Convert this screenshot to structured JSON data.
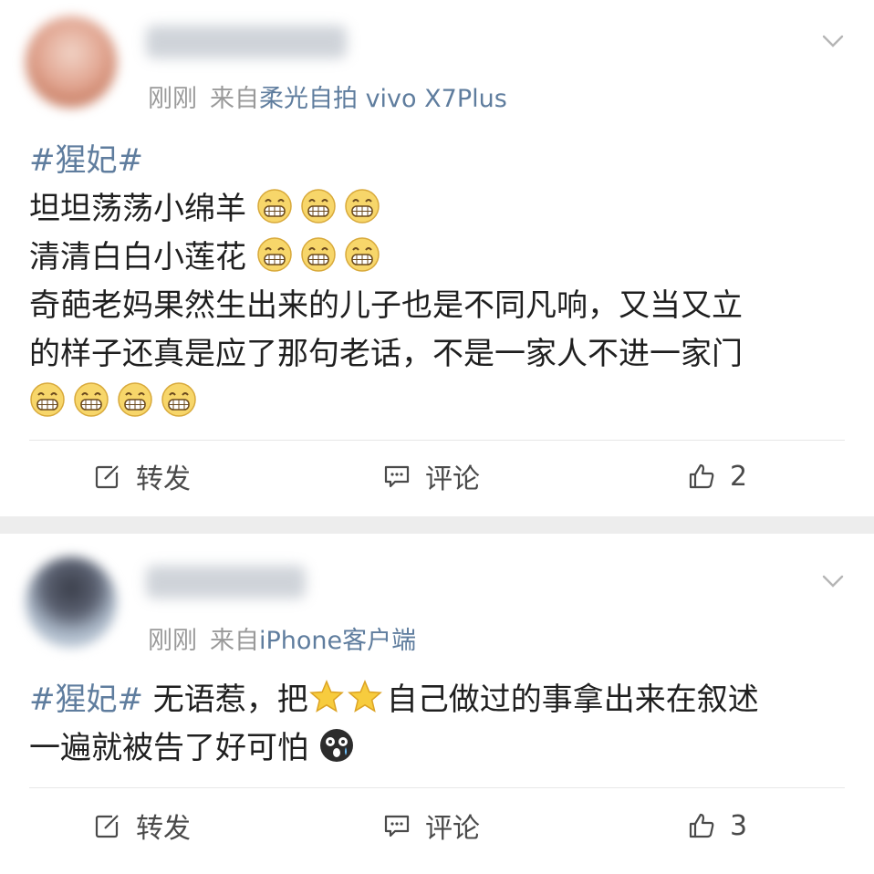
{
  "posts": [
    {
      "time": "刚刚",
      "source_prefix": "来自",
      "source": "柔光自拍 vivo X7Plus",
      "lines": [
        {
          "tag": "#猩妃#",
          "text": "",
          "emojis_after": []
        },
        {
          "tag": "",
          "text": "坦坦荡荡小绵羊",
          "emojis_after": [
            "grin-icon",
            "grin-icon",
            "grin-icon"
          ]
        },
        {
          "tag": "",
          "text": "清清白白小莲花",
          "emojis_after": [
            "grin-icon",
            "grin-icon",
            "grin-icon"
          ]
        },
        {
          "tag": "",
          "text": "奇葩老妈果然生出来的儿子也是不同凡响，又当又立",
          "emojis_after": []
        },
        {
          "tag": "",
          "text": "的样子还真是应了那句老话，不是一家人不进一家门",
          "emojis_after": []
        },
        {
          "tag": "",
          "text": "",
          "emojis_after": [
            "grin-icon",
            "grin-icon",
            "grin-icon",
            "grin-icon"
          ]
        }
      ],
      "actions": {
        "repost_label": "转发",
        "comment_label": "评论",
        "like_count": "2"
      }
    },
    {
      "time": "刚刚",
      "source_prefix": "来自",
      "source": "iPhone客户端",
      "line1_tag": "#猩妃#",
      "line1_text_a": "无语惹，把",
      "line1_emojis": [
        "star-icon",
        "star-icon"
      ],
      "line1_text_b": "自己做过的事拿出来在叙述",
      "line2_text": "一遍就被告了好可怕",
      "line2_emoji": "scared-face-icon",
      "actions": {
        "repost_label": "转发",
        "comment_label": "评论",
        "like_count": "3"
      }
    }
  ],
  "colors": {
    "link": "#5f7d9e",
    "meta": "#9a9a9a",
    "text": "#1f1f1f",
    "separator": "#ededed"
  }
}
